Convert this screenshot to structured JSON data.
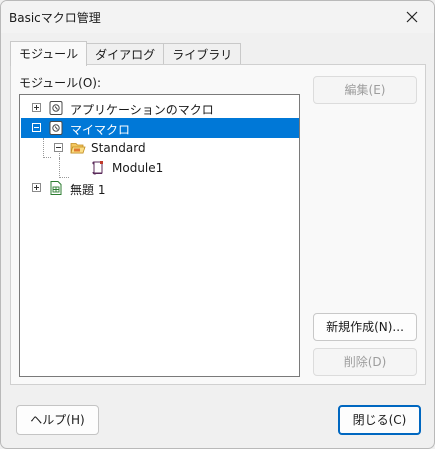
{
  "window": {
    "title": "Basicマクロ管理",
    "close_glyph": "✕"
  },
  "tabs": [
    {
      "label": "モジュール",
      "active": true
    },
    {
      "label": "ダイアログ",
      "active": false
    },
    {
      "label": "ライブラリ",
      "active": false
    }
  ],
  "panel": {
    "module_label": "モジュール(O):"
  },
  "tree": {
    "items": [
      {
        "label": "アプリケーションのマクロ",
        "icon": "macro-library-icon",
        "expanded": false,
        "selected": false
      },
      {
        "label": "マイマクロ",
        "icon": "macro-library-icon",
        "expanded": true,
        "selected": true
      },
      {
        "label": "Standard",
        "icon": "folder-open-icon",
        "expanded": true,
        "selected": false
      },
      {
        "label": "Module1",
        "icon": "basic-module-icon",
        "selected": false
      },
      {
        "label": "無題 1",
        "icon": "spreadsheet-document-icon",
        "expanded": false,
        "selected": false
      }
    ]
  },
  "buttons": {
    "edit": {
      "label": "編集(E)",
      "enabled": false
    },
    "new": {
      "label": "新規作成(N)...",
      "enabled": true
    },
    "delete": {
      "label": "削除(D)",
      "enabled": false
    },
    "help": {
      "label": "ヘルプ(H)"
    },
    "close": {
      "label": "閉じる(C)"
    }
  },
  "colors": {
    "selection": "#0078d7",
    "default_button_border": "#0067c0",
    "disabled_text": "#9d9d9d"
  }
}
